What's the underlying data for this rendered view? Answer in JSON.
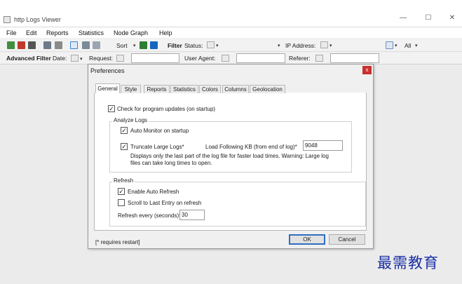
{
  "window": {
    "title": "http Logs Viewer",
    "minimize": "—",
    "maximize": "☐",
    "close": "✕"
  },
  "menu": [
    "File",
    "Edit",
    "Reports",
    "Statistics",
    "Node Graph",
    "Help"
  ],
  "toolbar": {
    "sort_label": "Sort",
    "filter_label": "Filter",
    "status_label": "Status:",
    "ip_label": "IP Address:",
    "all_label": "All"
  },
  "filterbar": {
    "advanced_label": "Advanced Filter",
    "date_label": "Date:",
    "request_label": "Request:",
    "user_agent_label": "User Agent:",
    "referer_label": "Referer:"
  },
  "dialog": {
    "title": "Preferences",
    "close_glyph": "x",
    "tabs": [
      "General",
      "Style",
      "Reports",
      "Statistics",
      "Colors",
      "Columns",
      "Geolocation"
    ],
    "active_tab": "General",
    "check_updates": {
      "label": "Check for program updates (on startup)",
      "checked": true
    },
    "analyze_logs": {
      "legend": "Analyze Logs",
      "auto_monitor": {
        "label": "Auto Monitor on startup",
        "checked": true
      },
      "truncate": {
        "label": "Truncate Large Logs*",
        "checked": true
      },
      "load_following_label": "Load Following KB (from end of log)*",
      "load_following_value": "9048",
      "note_line1": "Displays only the last part of the log file for faster load times. Warning: Large log",
      "note_line2": "files can take long times to open."
    },
    "refresh": {
      "legend": "Refresh",
      "enable_auto": {
        "label": "Enable Auto Refresh",
        "checked": true
      },
      "scroll_last": {
        "label": "Scroll to Last Entry on refresh",
        "checked": false
      },
      "every_label": "Refresh every (seconds)*",
      "every_value": "30"
    },
    "footnote": "[* requires restart]",
    "ok_label": "OK",
    "cancel_label": "Cancel"
  },
  "watermark": "最需教育",
  "colors": {
    "accent_blue": "#2f6fc0",
    "close_red": "#c9302c",
    "watermark": "#1a2fa6"
  }
}
